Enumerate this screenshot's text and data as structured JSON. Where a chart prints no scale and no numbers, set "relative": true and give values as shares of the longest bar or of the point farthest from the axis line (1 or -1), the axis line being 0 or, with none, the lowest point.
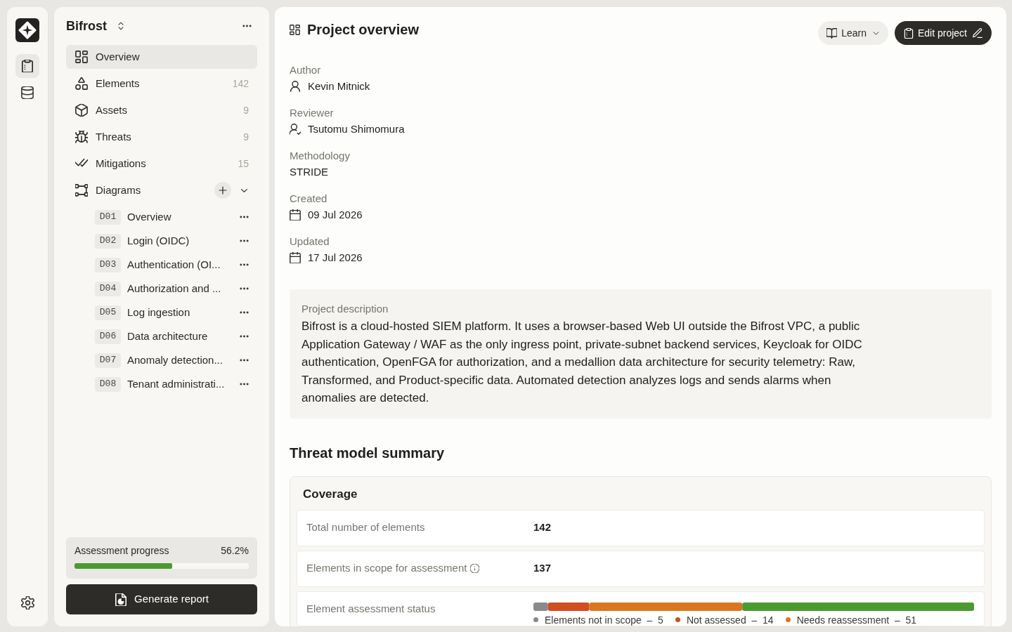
{
  "rail": {
    "items": [
      {
        "kind": "project",
        "selected": true
      },
      {
        "kind": "database",
        "selected": false
      }
    ]
  },
  "sidebar": {
    "project_name": "Bifrost",
    "nav": [
      {
        "kind": "overview",
        "label": "Overview",
        "selected": true
      },
      {
        "kind": "elements",
        "label": "Elements",
        "count": "142",
        "selected": false
      },
      {
        "kind": "assets",
        "label": "Assets",
        "count": "9",
        "selected": false
      },
      {
        "kind": "threats",
        "label": "Threats",
        "count": "9",
        "selected": false
      },
      {
        "kind": "mitigations",
        "label": "Mitigations",
        "count": "15",
        "selected": false
      },
      {
        "kind": "diagrams",
        "label": "Diagrams",
        "selected": false,
        "expanded": true,
        "children": [
          {
            "code": "D01",
            "label": "Overview",
            "selected": false
          },
          {
            "code": "D02",
            "label": "Login (OIDC)",
            "selected": false
          },
          {
            "code": "D03",
            "label": "Authentication (OI...",
            "selected": false
          },
          {
            "code": "D04",
            "label": "Authorization and ...",
            "selected": false
          },
          {
            "code": "D05",
            "label": "Log ingestion",
            "selected": false
          },
          {
            "code": "D06",
            "label": "Data architecture",
            "selected": false
          },
          {
            "code": "D07",
            "label": "Anomaly detection...",
            "selected": false
          },
          {
            "code": "D08",
            "label": "Tenant administrati...",
            "selected": false
          }
        ]
      }
    ],
    "progress": {
      "label": "Assessment progress",
      "reading": "56.2%",
      "level": 0.562
    },
    "generate_button": "Generate report"
  },
  "main": {
    "title": "Project overview",
    "buttons": [
      {
        "kind": "menu",
        "label": "Learn"
      },
      {
        "kind": "primary",
        "label": "Edit project"
      }
    ],
    "fields": [
      {
        "kind": "person",
        "label": "Author",
        "value": "Kevin Mitnick"
      },
      {
        "kind": "reviewer",
        "label": "Reviewer",
        "value": "Tsutomu Shimomura"
      },
      {
        "kind": "plain",
        "label": "Methodology",
        "value": "STRIDE"
      },
      {
        "kind": "date",
        "label": "Created",
        "value": "09 Jul 2026"
      },
      {
        "kind": "date",
        "label": "Updated",
        "value": "17 Jul 2026"
      }
    ],
    "description": {
      "label": "Project description",
      "text": "Bifrost is a cloud-hosted SIEM platform. It uses a browser-based Web UI outside the Bifrost VPC, a public Application Gateway / WAF as the only ingress point, private-subnet backend services, Keycloak for OIDC authentication, OpenFGA for authorization, and a medallion data architecture for security telemetry: Raw, Transformed, and Product-specific data. Automated detection analyzes logs and sends alarms when anomalies are detected."
    },
    "summary_title": "Threat model summary",
    "coverage": {
      "title": "Coverage",
      "rows": [
        {
          "kind": "value",
          "label": "Total number of elements",
          "value": "142",
          "info": false
        },
        {
          "kind": "value",
          "label": "Elements in scope for assessment",
          "value": "137",
          "info": true
        },
        {
          "kind": "status",
          "label": "Element assessment status",
          "chart_data": {
            "type": "bar",
            "orientation": "horizontal",
            "stacked": true,
            "relative": true,
            "series": [
              {
                "color": "#8a8a88",
                "values": [
                  0.033
                ]
              },
              {
                "color": "#d04e1f",
                "values": [
                  0.094
                ]
              },
              {
                "color": "#d9761f",
                "values": [
                  0.347
                ]
              },
              {
                "color": "#4a9a2f",
                "values": [
                  0.526
                ]
              }
            ]
          },
          "legend": [
            {
              "text": "Elements not in scope  –  5",
              "color": "#8a8a88"
            },
            {
              "text": "Not assessed  –  14",
              "color": "#d04e1f"
            },
            {
              "text": "Needs reassessment  –  51",
              "color": "#d9761f"
            }
          ]
        }
      ]
    }
  }
}
